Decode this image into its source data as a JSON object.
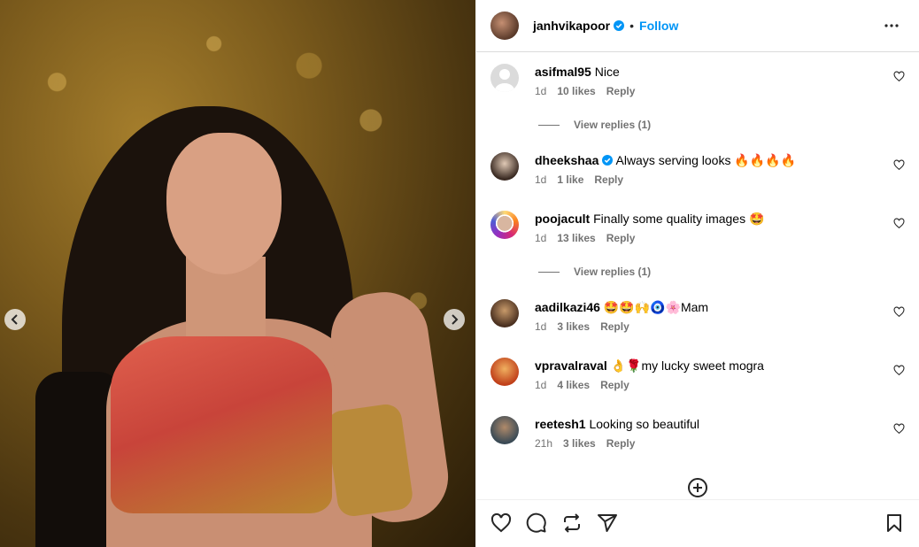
{
  "post": {
    "author": "janhvikapoor",
    "follow_label": "Follow",
    "separator": "•"
  },
  "icons": {
    "verified": "verified-badge-icon",
    "more": "more-options-icon",
    "heart": "heart-icon",
    "comment": "comment-icon",
    "share": "share-icon",
    "repost": "repost-icon",
    "save": "bookmark-icon",
    "add": "add-circle-icon",
    "prev": "chevron-left-icon",
    "next": "chevron-right-icon"
  },
  "colors": {
    "accent": "#0095f6",
    "muted": "#737373"
  },
  "comments": [
    {
      "user": "asifmal95",
      "verified": false,
      "text": "Nice",
      "time": "1d",
      "likes": "10 likes",
      "reply": "Reply",
      "view_replies": "View replies (1)"
    },
    {
      "user": "dheekshaa",
      "verified": true,
      "text": "Always serving looks 🔥🔥🔥🔥",
      "time": "1d",
      "likes": "1 like",
      "reply": "Reply"
    },
    {
      "user": "poojacult",
      "verified": false,
      "text": "Finally some quality images 🤩",
      "time": "1d",
      "likes": "13 likes",
      "reply": "Reply",
      "view_replies": "View replies (1)"
    },
    {
      "user": "aadilkazi46",
      "verified": false,
      "text": "🤩🤩🙌🧿🌸Mam",
      "time": "1d",
      "likes": "3 likes",
      "reply": "Reply"
    },
    {
      "user": "vpravalraval",
      "verified": false,
      "text": "👌🌹my lucky sweet mogra",
      "time": "1d",
      "likes": "4 likes",
      "reply": "Reply"
    },
    {
      "user": "reetesh1",
      "verified": false,
      "text": "Looking so beautiful",
      "time": "21h",
      "likes": "3 likes",
      "reply": "Reply"
    }
  ]
}
